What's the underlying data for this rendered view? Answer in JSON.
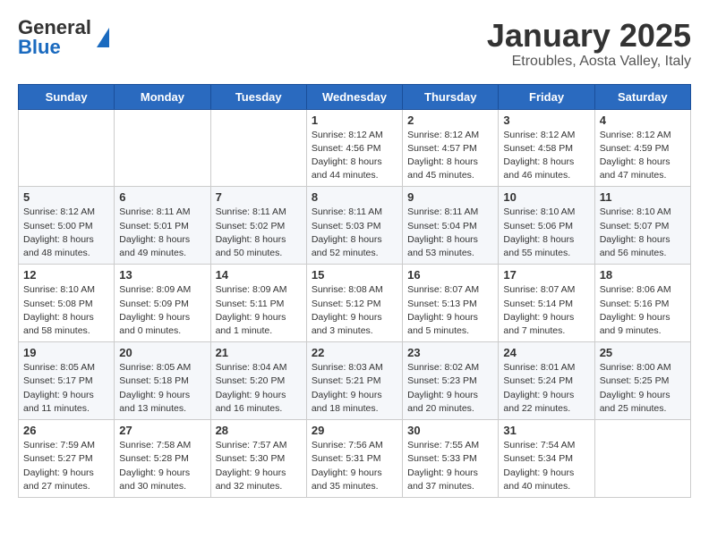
{
  "header": {
    "logo_general": "General",
    "logo_blue": "Blue",
    "month": "January 2025",
    "location": "Etroubles, Aosta Valley, Italy"
  },
  "days_of_week": [
    "Sunday",
    "Monday",
    "Tuesday",
    "Wednesday",
    "Thursday",
    "Friday",
    "Saturday"
  ],
  "weeks": [
    [
      {
        "day": "",
        "info": ""
      },
      {
        "day": "",
        "info": ""
      },
      {
        "day": "",
        "info": ""
      },
      {
        "day": "1",
        "info": "Sunrise: 8:12 AM\nSunset: 4:56 PM\nDaylight: 8 hours\nand 44 minutes."
      },
      {
        "day": "2",
        "info": "Sunrise: 8:12 AM\nSunset: 4:57 PM\nDaylight: 8 hours\nand 45 minutes."
      },
      {
        "day": "3",
        "info": "Sunrise: 8:12 AM\nSunset: 4:58 PM\nDaylight: 8 hours\nand 46 minutes."
      },
      {
        "day": "4",
        "info": "Sunrise: 8:12 AM\nSunset: 4:59 PM\nDaylight: 8 hours\nand 47 minutes."
      }
    ],
    [
      {
        "day": "5",
        "info": "Sunrise: 8:12 AM\nSunset: 5:00 PM\nDaylight: 8 hours\nand 48 minutes."
      },
      {
        "day": "6",
        "info": "Sunrise: 8:11 AM\nSunset: 5:01 PM\nDaylight: 8 hours\nand 49 minutes."
      },
      {
        "day": "7",
        "info": "Sunrise: 8:11 AM\nSunset: 5:02 PM\nDaylight: 8 hours\nand 50 minutes."
      },
      {
        "day": "8",
        "info": "Sunrise: 8:11 AM\nSunset: 5:03 PM\nDaylight: 8 hours\nand 52 minutes."
      },
      {
        "day": "9",
        "info": "Sunrise: 8:11 AM\nSunset: 5:04 PM\nDaylight: 8 hours\nand 53 minutes."
      },
      {
        "day": "10",
        "info": "Sunrise: 8:10 AM\nSunset: 5:06 PM\nDaylight: 8 hours\nand 55 minutes."
      },
      {
        "day": "11",
        "info": "Sunrise: 8:10 AM\nSunset: 5:07 PM\nDaylight: 8 hours\nand 56 minutes."
      }
    ],
    [
      {
        "day": "12",
        "info": "Sunrise: 8:10 AM\nSunset: 5:08 PM\nDaylight: 8 hours\nand 58 minutes."
      },
      {
        "day": "13",
        "info": "Sunrise: 8:09 AM\nSunset: 5:09 PM\nDaylight: 9 hours\nand 0 minutes."
      },
      {
        "day": "14",
        "info": "Sunrise: 8:09 AM\nSunset: 5:11 PM\nDaylight: 9 hours\nand 1 minute."
      },
      {
        "day": "15",
        "info": "Sunrise: 8:08 AM\nSunset: 5:12 PM\nDaylight: 9 hours\nand 3 minutes."
      },
      {
        "day": "16",
        "info": "Sunrise: 8:07 AM\nSunset: 5:13 PM\nDaylight: 9 hours\nand 5 minutes."
      },
      {
        "day": "17",
        "info": "Sunrise: 8:07 AM\nSunset: 5:14 PM\nDaylight: 9 hours\nand 7 minutes."
      },
      {
        "day": "18",
        "info": "Sunrise: 8:06 AM\nSunset: 5:16 PM\nDaylight: 9 hours\nand 9 minutes."
      }
    ],
    [
      {
        "day": "19",
        "info": "Sunrise: 8:05 AM\nSunset: 5:17 PM\nDaylight: 9 hours\nand 11 minutes."
      },
      {
        "day": "20",
        "info": "Sunrise: 8:05 AM\nSunset: 5:18 PM\nDaylight: 9 hours\nand 13 minutes."
      },
      {
        "day": "21",
        "info": "Sunrise: 8:04 AM\nSunset: 5:20 PM\nDaylight: 9 hours\nand 16 minutes."
      },
      {
        "day": "22",
        "info": "Sunrise: 8:03 AM\nSunset: 5:21 PM\nDaylight: 9 hours\nand 18 minutes."
      },
      {
        "day": "23",
        "info": "Sunrise: 8:02 AM\nSunset: 5:23 PM\nDaylight: 9 hours\nand 20 minutes."
      },
      {
        "day": "24",
        "info": "Sunrise: 8:01 AM\nSunset: 5:24 PM\nDaylight: 9 hours\nand 22 minutes."
      },
      {
        "day": "25",
        "info": "Sunrise: 8:00 AM\nSunset: 5:25 PM\nDaylight: 9 hours\nand 25 minutes."
      }
    ],
    [
      {
        "day": "26",
        "info": "Sunrise: 7:59 AM\nSunset: 5:27 PM\nDaylight: 9 hours\nand 27 minutes."
      },
      {
        "day": "27",
        "info": "Sunrise: 7:58 AM\nSunset: 5:28 PM\nDaylight: 9 hours\nand 30 minutes."
      },
      {
        "day": "28",
        "info": "Sunrise: 7:57 AM\nSunset: 5:30 PM\nDaylight: 9 hours\nand 32 minutes."
      },
      {
        "day": "29",
        "info": "Sunrise: 7:56 AM\nSunset: 5:31 PM\nDaylight: 9 hours\nand 35 minutes."
      },
      {
        "day": "30",
        "info": "Sunrise: 7:55 AM\nSunset: 5:33 PM\nDaylight: 9 hours\nand 37 minutes."
      },
      {
        "day": "31",
        "info": "Sunrise: 7:54 AM\nSunset: 5:34 PM\nDaylight: 9 hours\nand 40 minutes."
      },
      {
        "day": "",
        "info": ""
      }
    ]
  ]
}
